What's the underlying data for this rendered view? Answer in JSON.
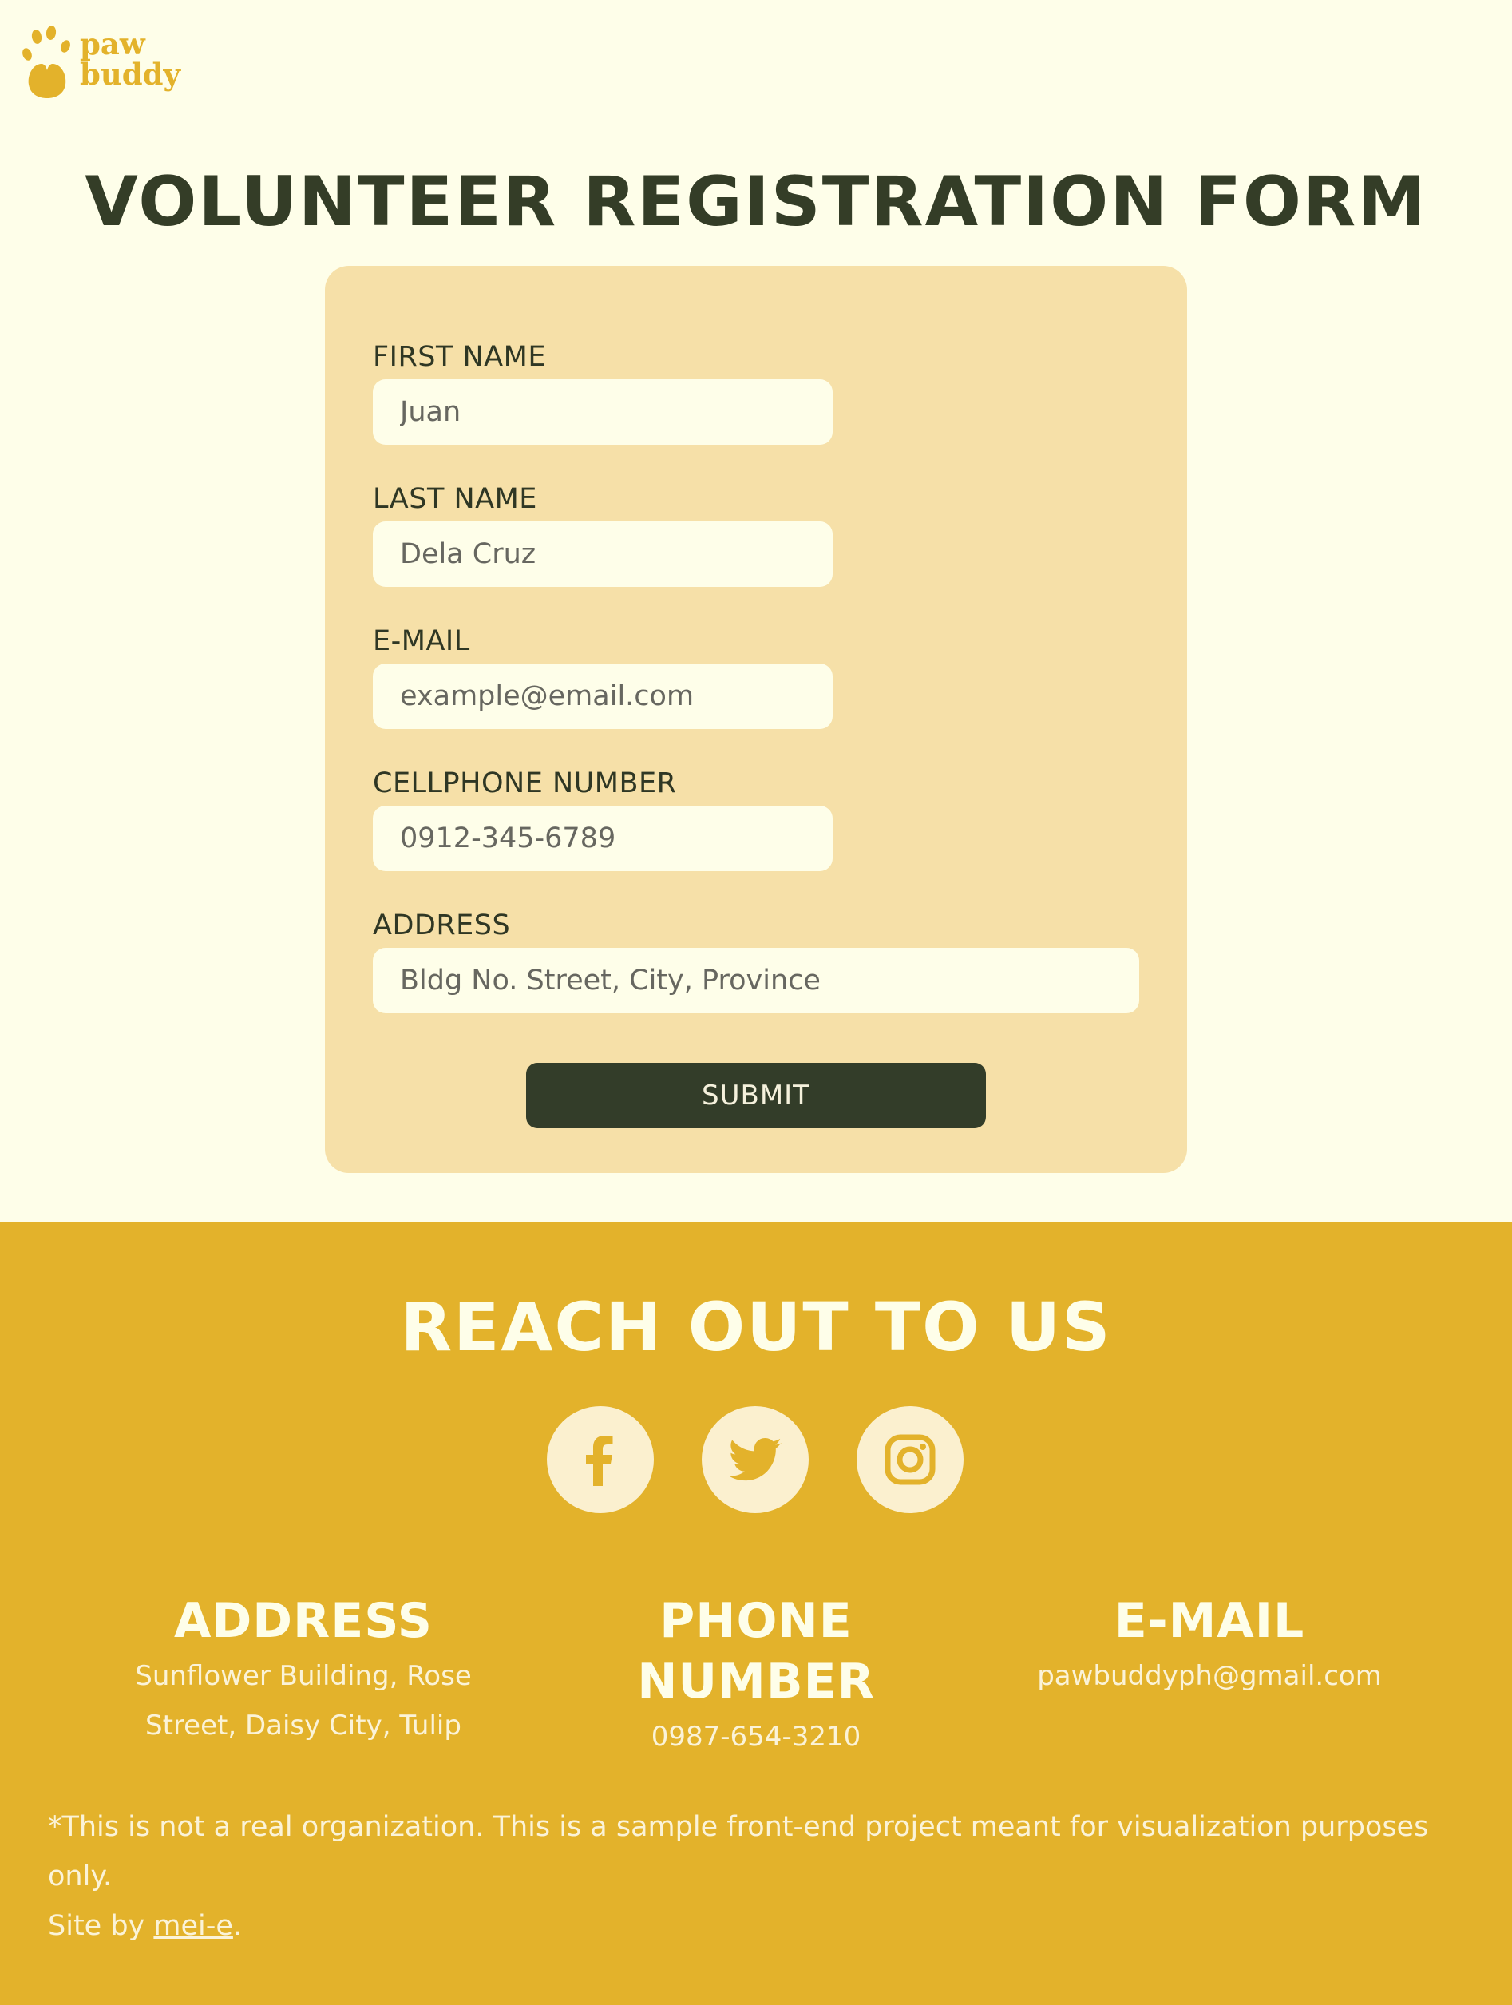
{
  "brand": {
    "line1": "paw",
    "line2": "buddy",
    "color": "#e3b22b",
    "icon": "paw-icon"
  },
  "page": {
    "title": "VOLUNTEER REGISTRATION FORM"
  },
  "form": {
    "first_name": {
      "label": "FIRST NAME",
      "placeholder": "Juan"
    },
    "last_name": {
      "label": "LAST NAME",
      "placeholder": "Dela Cruz"
    },
    "email": {
      "label": "E-MAIL",
      "placeholder": "example@email.com"
    },
    "phone": {
      "label": "CELLPHONE NUMBER",
      "placeholder": "0912-345-6789"
    },
    "address": {
      "label": "ADDRESS",
      "placeholder": "Bldg No. Street, City, Province"
    },
    "submit_label": "SUBMIT"
  },
  "footer": {
    "heading": "REACH OUT TO US",
    "socials": [
      {
        "icon": "facebook-icon"
      },
      {
        "icon": "twitter-icon"
      },
      {
        "icon": "instagram-icon"
      }
    ],
    "address": {
      "heading": "ADDRESS",
      "line1": "Sunflower Building, Rose",
      "line2": "Street, Daisy City, Tulip"
    },
    "phone": {
      "heading": "PHONE NUMBER",
      "value": "0987-654-3210"
    },
    "email": {
      "heading": "E-MAIL",
      "value": "pawbuddyph@gmail.com"
    },
    "disclaimer": "*This is not a real organization. This is a sample front-end project meant for visualization purposes only.",
    "credit_prefix": "Site by ",
    "credit_link": "mei-e",
    "credit_suffix": "."
  },
  "colors": {
    "background": "#fefee9",
    "card": "#f6e0a8",
    "accent": "#e3b22b",
    "dark": "#333d29"
  }
}
